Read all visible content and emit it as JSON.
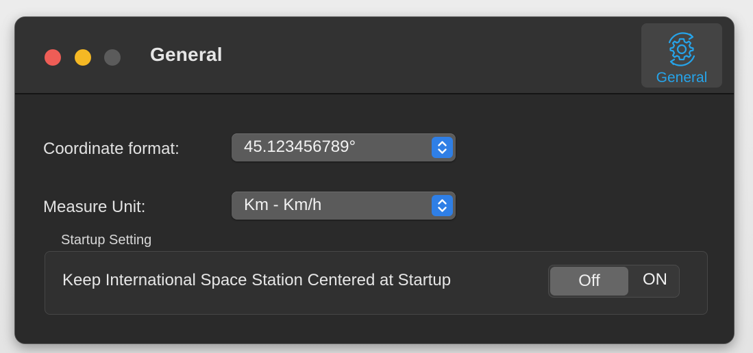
{
  "window": {
    "title": "General"
  },
  "toolbar": {
    "general_label": "General",
    "general_icon": "gear-cycle-icon",
    "accent_color": "#26a4ea"
  },
  "settings": {
    "coordinate_format": {
      "label": "Coordinate format:",
      "value": "45.123456789°"
    },
    "measure_unit": {
      "label": "Measure Unit:",
      "value": "Km - Km/h"
    }
  },
  "startup": {
    "group_title": "Startup Setting",
    "keep_centered_label": "Keep International Space Station Centered at Startup",
    "toggle": {
      "off_label": "Off",
      "on_label": "ON",
      "selected": "Off"
    }
  },
  "colors": {
    "close": "#ee5d56",
    "minimize": "#f5b824",
    "zoom_inactive": "#5b5b5b",
    "popup_accent": "#2f7fe6"
  }
}
